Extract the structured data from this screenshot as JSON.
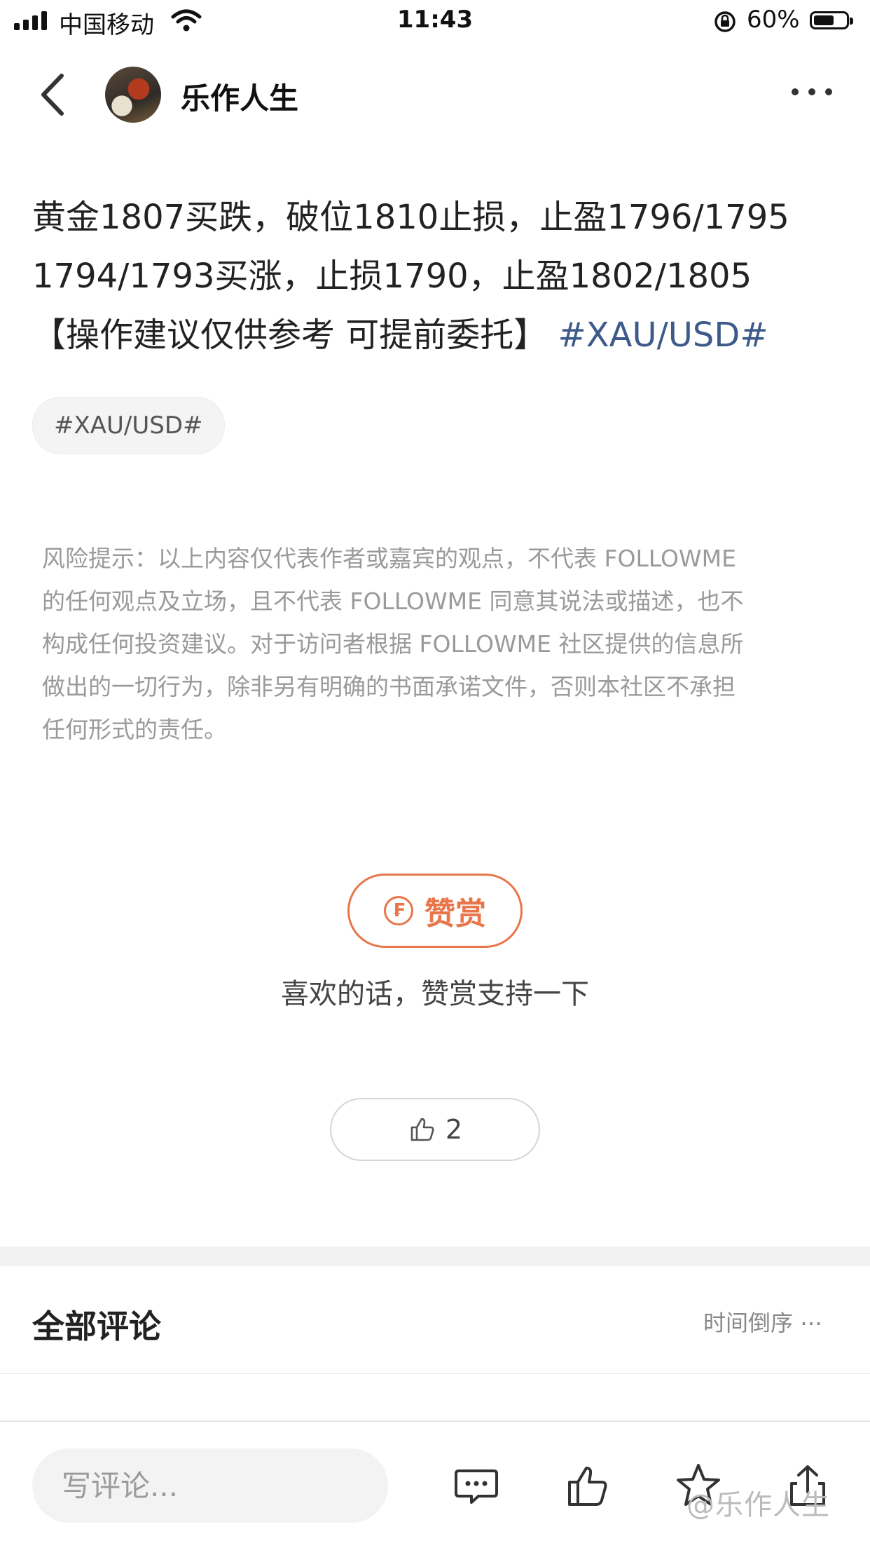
{
  "status_bar": {
    "carrier": "中国移动",
    "time": "11:43",
    "battery": "60%",
    "battery_level": 0.6
  },
  "nav": {
    "author": "乐作人生"
  },
  "post": {
    "lines": [
      "黄金1807买跌，破位1810止损，止盈1796/1795",
      "1794/1793买涨，止损1790，止盈1802/1805",
      "【操作建议仅供参考 可提前委托】"
    ],
    "inline_hashtag": "#XAU/USD#",
    "tag": "#XAU/USD#"
  },
  "disclaimer": {
    "lines": [
      "风险提示：以上内容仅代表作者或嘉宾的观点，不代表 FOLLOWME",
      "的任何观点及立场，且不代表 FOLLOWME 同意其说法或描述，也不",
      "构成任何投资建议。对于访问者根据 FOLLOWME 社区提供的信息所",
      "做出的一切行为，除非另有明确的书面承诺文件，否则本社区不承担",
      "任何形式的责任。"
    ]
  },
  "reward": {
    "label": "赞赏",
    "icon_glyph": "₣",
    "hint": "喜欢的话，赞赏支持一下"
  },
  "like": {
    "count": "2"
  },
  "comments": {
    "title": "全部评论",
    "sort": "时间倒序 ⋯"
  },
  "bottom_bar": {
    "comment_placeholder": "写评论..."
  },
  "watermark": "@乐作人生",
  "colors": {
    "accent": "#e8764a",
    "hashtag": "#3d5a8a"
  }
}
